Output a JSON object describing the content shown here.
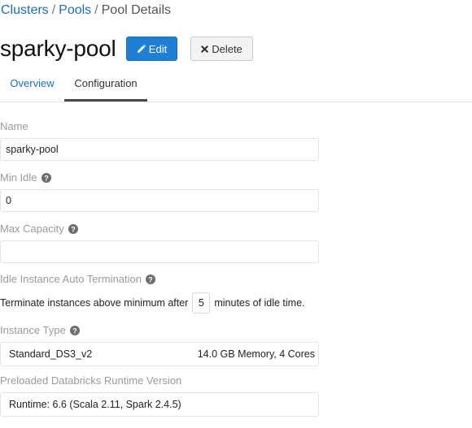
{
  "breadcrumb": {
    "clusters": "Clusters",
    "pools": "Pools",
    "separator": "/",
    "current": "Pool Details"
  },
  "header": {
    "title": "sparky-pool",
    "edit_label": "Edit",
    "delete_label": "Delete"
  },
  "tabs": [
    {
      "label": "Overview",
      "active": false
    },
    {
      "label": "Configuration",
      "active": true
    }
  ],
  "form": {
    "name": {
      "label": "Name",
      "value": "sparky-pool"
    },
    "min_idle": {
      "label": "Min Idle",
      "value": "0"
    },
    "max_capacity": {
      "label": "Max Capacity",
      "value": ""
    },
    "auto_termination": {
      "label": "Idle Instance Auto Termination",
      "prefix": "Terminate instances above minimum after",
      "minutes": "5",
      "suffix": "minutes of idle time."
    },
    "instance_type": {
      "label": "Instance Type",
      "value": "Standard_DS3_v2",
      "detail": "14.0 GB Memory, 4 Cores"
    },
    "runtime": {
      "label": "Preloaded Databricks Runtime Version",
      "value": "Runtime: 6.6 (Scala 2.11, Spark 2.4.5)"
    }
  },
  "icons": {
    "edit": "pencil-icon",
    "delete": "x-icon",
    "help": "question-circle-icon"
  },
  "colors": {
    "link": "#1a6eb5",
    "primary_button": "#1f7fd4",
    "label": "#9a9a9a"
  }
}
